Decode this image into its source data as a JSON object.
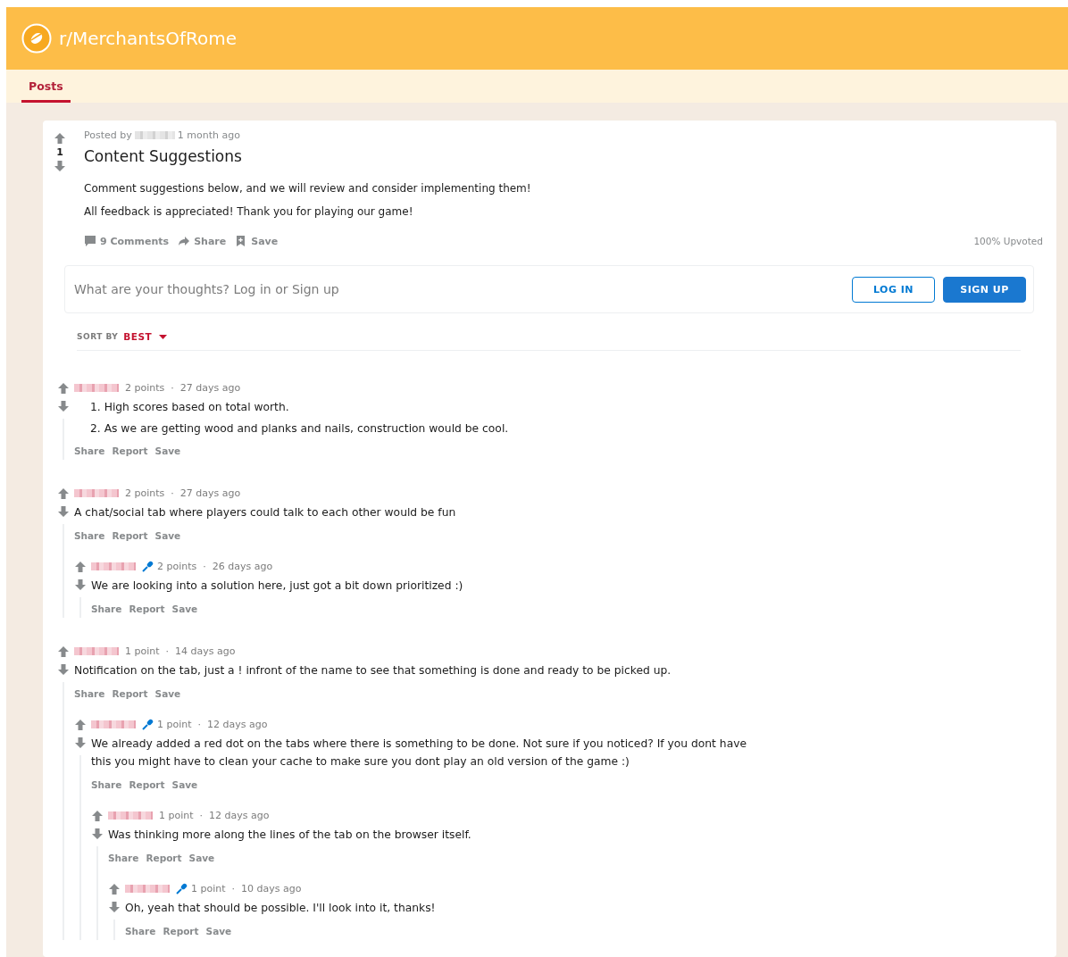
{
  "header": {
    "title": "r/MerchantsOfRome"
  },
  "tabs": [
    {
      "label": "Posts",
      "selected": true
    }
  ],
  "post": {
    "score": "1",
    "posted_by": "Posted by",
    "time": "1 month ago",
    "title": "Content Suggestions",
    "body": [
      "Comment suggestions below, and we will review and consider implementing them!",
      "All feedback is appreciated! Thank you for playing our game!"
    ],
    "actions": [
      {
        "kind": "comments",
        "label": "9 Comments"
      },
      {
        "kind": "share",
        "label": "Share"
      },
      {
        "kind": "save",
        "label": "Save"
      }
    ],
    "upvoted": "100% Upvoted"
  },
  "comment_box": {
    "placeholder": "What are your thoughts? Log in or Sign up",
    "buttons": [
      {
        "kind": "outline",
        "label": "LOG IN"
      },
      {
        "kind": "primary",
        "label": "SIGN UP"
      }
    ]
  },
  "sort": {
    "label": "SORT BY",
    "value": "BEST"
  },
  "comments": [
    {
      "points": "2 points",
      "separator": "·",
      "time": "27 days ago",
      "mod": false,
      "kind": "list",
      "body": [
        "1. High scores based on total worth.",
        "2. As we are getting wood and planks and nails, construction would be cool."
      ],
      "actions": [
        "Share",
        "Report",
        "Save"
      ]
    },
    {
      "points": "2 points",
      "separator": "·",
      "time": "27 days ago",
      "mod": false,
      "kind": "text",
      "body": [
        "A chat/social tab where players could talk to each other would be fun"
      ],
      "actions": [
        "Share",
        "Report",
        "Save"
      ],
      "children": [
        {
          "points": "2 points",
          "separator": "·",
          "time": "26 days ago",
          "mod": true,
          "kind": "text",
          "body": [
            "We are looking into a solution here, just got a bit down prioritized :)"
          ],
          "actions": [
            "Share",
            "Report",
            "Save"
          ]
        }
      ]
    },
    {
      "points": "1 point",
      "separator": "·",
      "time": "14 days ago",
      "mod": false,
      "kind": "text",
      "body": [
        "Notification on the tab, just a ! infront of the name to see that something is done and ready to be picked up."
      ],
      "actions": [
        "Share",
        "Report",
        "Save"
      ],
      "children": [
        {
          "points": "1 point",
          "separator": "·",
          "time": "12 days ago",
          "mod": true,
          "kind": "text",
          "body": [
            "We already added a red dot on the tabs where there is something to be done. Not sure if you noticed? If you dont have this you might have to clean your cache to make sure you dont play an old version of the game :)"
          ],
          "actions": [
            "Share",
            "Report",
            "Save"
          ],
          "children": [
            {
              "points": "1 point",
              "separator": "·",
              "time": "12 days ago",
              "mod": false,
              "kind": "text",
              "body": [
                "Was thinking more along the lines of the tab on the browser itself."
              ],
              "actions": [
                "Share",
                "Report",
                "Save"
              ],
              "children": [
                {
                  "points": "1 point",
                  "separator": "·",
                  "time": "10 days ago",
                  "mod": true,
                  "kind": "text",
                  "body": [
                    "Oh, yeah that should be possible. I'll look into it, thanks!"
                  ],
                  "actions": [
                    "Share",
                    "Report",
                    "Save"
                  ]
                }
              ]
            }
          ]
        }
      ]
    }
  ]
}
